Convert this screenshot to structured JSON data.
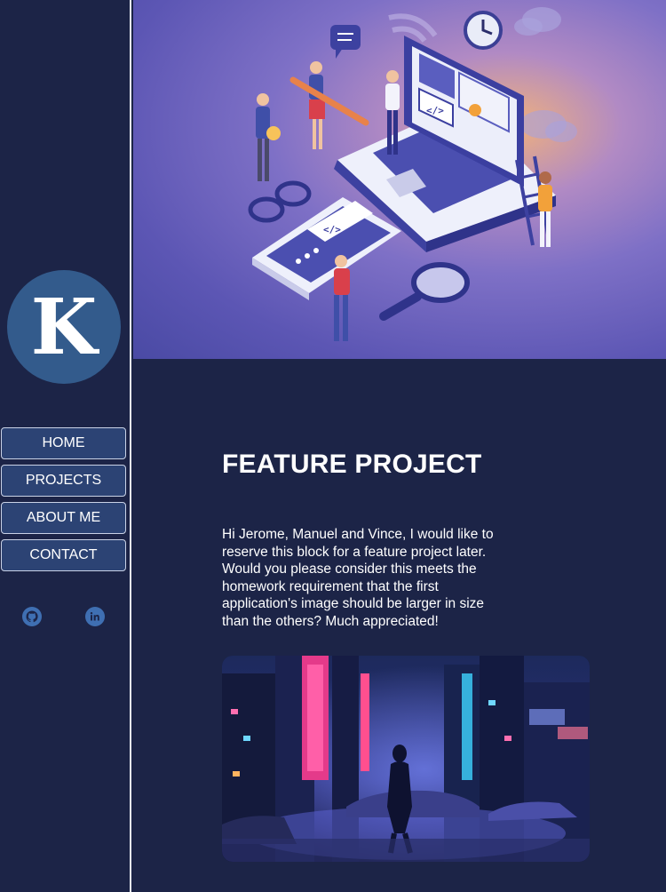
{
  "sidebar": {
    "logo_letter": "K",
    "nav": [
      {
        "label": "HOME"
      },
      {
        "label": "PROJECTS"
      },
      {
        "label": "ABOUT ME"
      },
      {
        "label": "CONTACT"
      }
    ],
    "social": [
      {
        "icon": "github-icon"
      },
      {
        "icon": "linkedin-icon"
      }
    ]
  },
  "hero": {
    "icon": "developers-laptop-illustration"
  },
  "feature": {
    "title": "FEATURE PROJECT",
    "description": "Hi Jerome, Manuel and Vince, I would like to reserve this block for a feature project later. Would you please consider this meets the homework requirement that the first application's image should be larger in size than the others? Much appreciated!",
    "image_icon": "neon-city-street-illustration"
  },
  "colors": {
    "background": "#1c2447",
    "button": "#2c4374",
    "logo": "#335b8c",
    "social": "#3f6fb2"
  }
}
